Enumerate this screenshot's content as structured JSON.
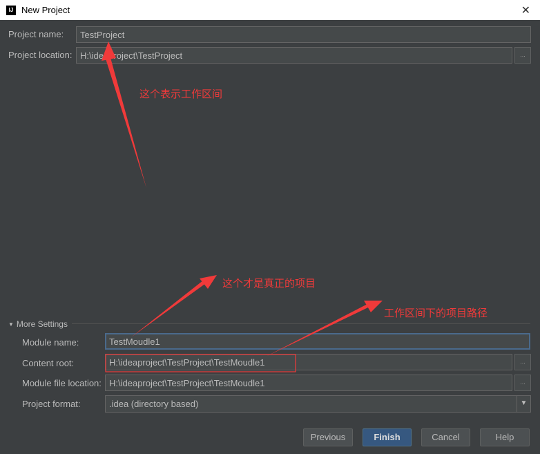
{
  "window": {
    "title": "New Project",
    "icon": "intellij-logo",
    "logo_text": "IJ"
  },
  "form": {
    "project_name_label": "Project name:",
    "project_name": "TestProject",
    "project_location_label": "Project location:",
    "project_location": "H:\\ideaproject\\TestProject",
    "more_settings": "More Settings",
    "module_name_label": "Module name:",
    "module_name": "TestMoudle1",
    "content_root_label": "Content root:",
    "content_root": "H:\\ideaproject\\TestProject\\TestMoudle1",
    "module_file_location_label": "Module file location:",
    "module_file_location": "H:\\ideaproject\\TestProject\\TestMoudle1",
    "project_format_label": "Project format:",
    "project_format": ".idea (directory based)",
    "browse": "..."
  },
  "buttons": {
    "previous": "Previous",
    "finish": "Finish",
    "cancel": "Cancel",
    "help": "Help"
  },
  "annotations": {
    "workspace": "这个表示工作区间",
    "real_project": "这个才是真正的项目",
    "project_path": "工作区间下的项目路径",
    "color": "#f03a3a"
  }
}
